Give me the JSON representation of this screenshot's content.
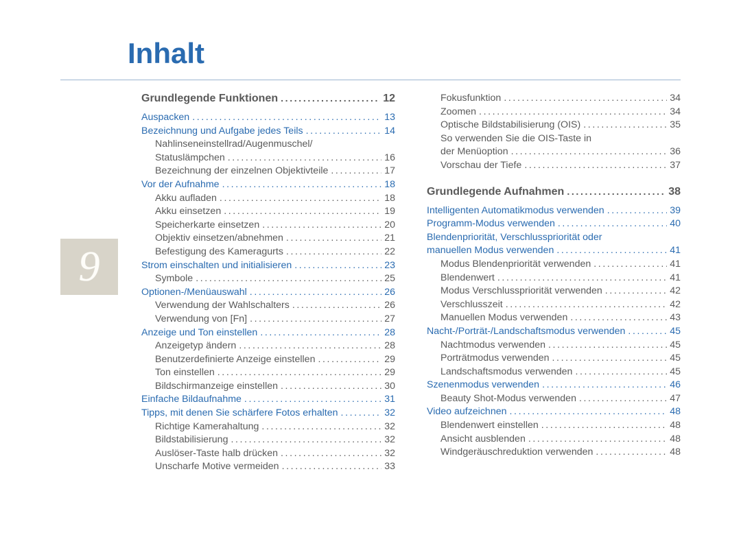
{
  "title": "Inhalt",
  "side_page_number": "9",
  "dots_fill": ".........................................................................................",
  "left": [
    {
      "type": "chapter",
      "label": "Grundlegende Funktionen",
      "page": "12"
    },
    {
      "type": "section",
      "label": "Auspacken",
      "page": "13"
    },
    {
      "type": "section",
      "label": "Bezeichnung und Aufgabe jedes Teils",
      "page": "14"
    },
    {
      "type": "sub-nolead",
      "label": "Nahlinseneinstellrad/Augenmuschel/"
    },
    {
      "type": "sub",
      "label": "Statuslämpchen",
      "page": "16"
    },
    {
      "type": "sub",
      "label": "Bezeichnung der einzelnen Objektivteile",
      "page": "17"
    },
    {
      "type": "section",
      "label": "Vor der Aufnahme",
      "page": "18"
    },
    {
      "type": "sub",
      "label": "Akku aufladen",
      "page": "18"
    },
    {
      "type": "sub",
      "label": "Akku einsetzen",
      "page": "19"
    },
    {
      "type": "sub",
      "label": "Speicherkarte einsetzen",
      "page": "20"
    },
    {
      "type": "sub",
      "label": "Objektiv einsetzen/abnehmen",
      "page": "21"
    },
    {
      "type": "sub",
      "label": "Befestigung des Kameragurts",
      "page": "22"
    },
    {
      "type": "section",
      "label": "Strom einschalten und initialisieren",
      "page": "23"
    },
    {
      "type": "sub",
      "label": "Symbole",
      "page": "25"
    },
    {
      "type": "section",
      "label": "Optionen-/Menüauswahl",
      "page": "26"
    },
    {
      "type": "sub",
      "label": "Verwendung der Wahlschalters",
      "page": "26"
    },
    {
      "type": "sub",
      "label": "Verwendung von  [Fn]",
      "page": "27"
    },
    {
      "type": "section",
      "label": "Anzeige und Ton einstellen",
      "page": "28"
    },
    {
      "type": "sub",
      "label": "Anzeigetyp ändern",
      "page": "28"
    },
    {
      "type": "sub",
      "label": "Benutzerdefinierte Anzeige einstellen",
      "page": "29"
    },
    {
      "type": "sub",
      "label": "Ton einstellen",
      "page": "29"
    },
    {
      "type": "sub",
      "label": "Bildschirmanzeige einstellen",
      "page": "30"
    },
    {
      "type": "section",
      "label": "Einfache Bildaufnahme",
      "page": "31"
    },
    {
      "type": "section",
      "label": "Tipps,  mit denen Sie schärfere Fotos erhalten",
      "page": "32"
    },
    {
      "type": "sub",
      "label": "Richtige Kamerahaltung",
      "page": "32"
    },
    {
      "type": "sub",
      "label": "Bildstabilisierung",
      "page": "32"
    },
    {
      "type": "sub",
      "label": "Auslöser-Taste halb drücken",
      "page": "32"
    },
    {
      "type": "sub",
      "label": "Unscharfe Motive vermeiden",
      "page": "33"
    }
  ],
  "right": [
    {
      "type": "sub",
      "label": "Fokusfunktion",
      "page": "34"
    },
    {
      "type": "sub",
      "label": "Zoomen",
      "page": "34"
    },
    {
      "type": "sub",
      "label": "Optische Bildstabilisierung (OIS)",
      "page": "35"
    },
    {
      "type": "sub-nolead",
      "label": "So verwenden Sie die OIS-Taste in"
    },
    {
      "type": "sub",
      "label": "der Menüoption",
      "page": "36"
    },
    {
      "type": "sub",
      "label": "Vorschau der Tiefe",
      "page": "37"
    },
    {
      "type": "spacer"
    },
    {
      "type": "chapter",
      "label": "Grundlegende Aufnahmen",
      "page": "38"
    },
    {
      "type": "section",
      "label": "Intelligenten Automatikmodus verwenden",
      "page": "39"
    },
    {
      "type": "section",
      "label": "Programm-Modus verwenden",
      "page": "40"
    },
    {
      "type": "section-nolead",
      "label": "Blendenpriorität, Verschlusspriorität oder"
    },
    {
      "type": "section",
      "label": "manuellen Modus verwenden",
      "page": "41"
    },
    {
      "type": "sub",
      "label": "Modus Blendenpriorität verwenden",
      "page": "41"
    },
    {
      "type": "sub",
      "label": "Blendenwert",
      "page": "41"
    },
    {
      "type": "sub",
      "label": "Modus  Verschlusspriorität  verwenden",
      "page": "42"
    },
    {
      "type": "sub",
      "label": "Verschlusszeit",
      "page": "42"
    },
    {
      "type": "sub",
      "label": "Manuellen Modus verwenden",
      "page": "43"
    },
    {
      "type": "section",
      "label": "Nacht-/Porträt-/Landschaftsmodus verwenden",
      "page": "45"
    },
    {
      "type": "sub",
      "label": "Nachtmodus verwenden",
      "page": "45"
    },
    {
      "type": "sub",
      "label": "Porträtmodus verwenden",
      "page": "45"
    },
    {
      "type": "sub",
      "label": "Landschaftsmodus verwenden",
      "page": "45"
    },
    {
      "type": "section",
      "label": "Szenenmodus verwenden",
      "page": "46"
    },
    {
      "type": "sub",
      "label": "Beauty Shot-Modus verwenden",
      "page": "47"
    },
    {
      "type": "section",
      "label": "Video aufzeichnen",
      "page": "48"
    },
    {
      "type": "sub",
      "label": "Blendenwert einstellen",
      "page": "48"
    },
    {
      "type": "sub",
      "label": "Ansicht ausblenden",
      "page": "48"
    },
    {
      "type": "sub",
      "label": "Windgeräuschreduktion verwenden",
      "page": "48"
    }
  ]
}
